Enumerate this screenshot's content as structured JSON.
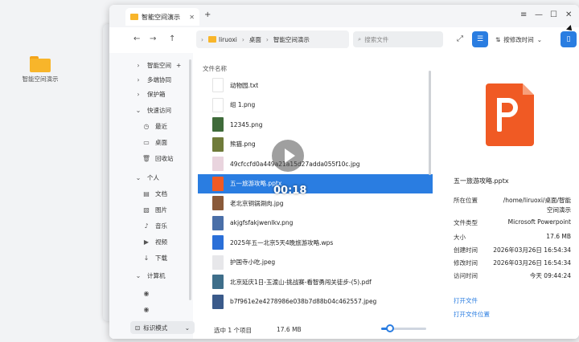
{
  "desktop": {
    "folder_label": "智能空间演示"
  },
  "background_window": {
    "rows": [
      "智",
      "⊞",
      "多",
      "保",
      "快",
      "⊙",
      "▢",
      "⊡",
      "个",
      "⊞",
      "♪",
      "▶",
      "↓",
      "计",
      "⊡"
    ]
  },
  "window": {
    "tab_title": "智能空间演示",
    "add_tab": "+",
    "controls": {
      "menu": "≡",
      "minimize": "—",
      "maximize": "☐",
      "close": "✕"
    }
  },
  "toolbar": {
    "back": "←",
    "forward": "→",
    "up": "↑",
    "breadcrumb": [
      "liruoxi",
      "桌面",
      "智能空间演示"
    ],
    "search_placeholder": "搜索文件",
    "sort_label": "按修改时间",
    "sort_icon": "sort-icon"
  },
  "sidebar": {
    "items": [
      {
        "label": "智能空间",
        "icon": "arrow",
        "extra": "+"
      },
      {
        "label": "多端协同",
        "icon": "arrow"
      },
      {
        "label": "保护箱",
        "icon": "arrow"
      },
      {
        "label": "快速访问",
        "icon": "arrow-down"
      },
      {
        "label": "最近",
        "icon": "clock"
      },
      {
        "label": "桌面",
        "icon": "desktop"
      },
      {
        "label": "回收站",
        "icon": "trash"
      },
      {
        "label": "个人",
        "icon": "arrow-down"
      },
      {
        "label": "文档",
        "icon": "doc"
      },
      {
        "label": "图片",
        "icon": "image"
      },
      {
        "label": "音乐",
        "icon": "music"
      },
      {
        "label": "视频",
        "icon": "video"
      },
      {
        "label": "下载",
        "icon": "download"
      },
      {
        "label": "计算机",
        "icon": "arrow-down"
      },
      {
        "label": "",
        "icon": "disk"
      },
      {
        "label": "",
        "icon": "disk"
      }
    ],
    "mode_label": "标识模式"
  },
  "list": {
    "column_header": "文件名称",
    "files": [
      {
        "name": "动物园.txt",
        "color": "#ffffff"
      },
      {
        "name": "组 1.png",
        "color": "#ffffff"
      },
      {
        "name": "12345.png",
        "color": "#3f6b3a"
      },
      {
        "name": "熊猫.png",
        "color": "#6f7b3a"
      },
      {
        "name": "49cfccfd0a449a21a15d27adda055f10c.jpg",
        "color": "#e9d4de"
      },
      {
        "name": "五一旅游攻略.pptx",
        "color": "#f05a24",
        "selected": true
      },
      {
        "name": "老北京铜锅涮肉.jpg",
        "color": "#8a5a3a"
      },
      {
        "name": "akjgfsfakjwenlkv.png",
        "color": "#4a6fa8"
      },
      {
        "name": "2025年五一北京5天4晚旅游攻略.wps",
        "color": "#2a6fd8"
      },
      {
        "name": "护国寺小吃.jpeg",
        "color": "#e7e7ea"
      },
      {
        "name": "北京延庆1日-玉渡山-挑战赛-看智勇闯关徒步-(5).pdf",
        "color": "#3e6e8a"
      },
      {
        "name": "b7f961e2e4278986e038b7d88b04c462557.jpeg",
        "color": "#3a5a8a"
      }
    ],
    "status": "选中 1 个项目",
    "status_size": "17.6 MB",
    "timecode": "00:18"
  },
  "detail": {
    "name": "五一旅游攻略.pptx",
    "rows": [
      {
        "k": "所在位置",
        "v": "/home/liruoxi/桌面/智能空间演示"
      },
      {
        "k": "文件类型",
        "v": "Microsoft Powerpoint"
      },
      {
        "k": "大小",
        "v": "17.6 MB"
      },
      {
        "k": "创建时间",
        "v": "2026年03月26日 16:54:34"
      },
      {
        "k": "修改时间",
        "v": "2026年03月26日 16:54:34"
      },
      {
        "k": "访问时间",
        "v": "今天 09:44:24"
      }
    ],
    "open_file": "打开文件",
    "open_location": "打开文件位置"
  }
}
